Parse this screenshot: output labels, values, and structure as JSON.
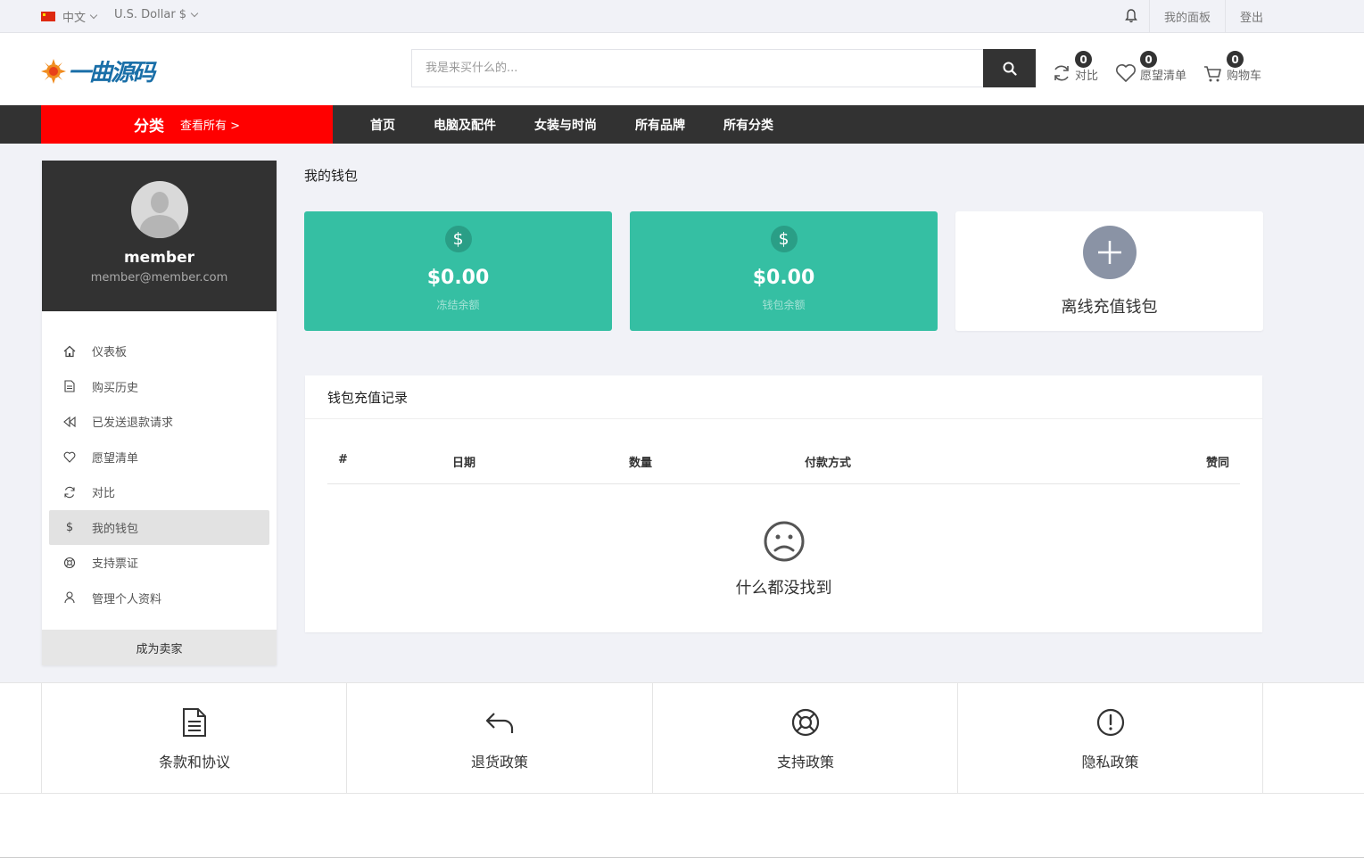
{
  "topbar": {
    "language": "中文",
    "currency": "U.S. Dollar $",
    "dashboard_link": "我的面板",
    "logout_link": "登出"
  },
  "header": {
    "logo_text": "一曲源码",
    "search_placeholder": "我是来买什么的...",
    "compare": {
      "count": "0",
      "label": "对比"
    },
    "wishlist": {
      "count": "0",
      "label": "愿望清单"
    },
    "cart": {
      "count": "0",
      "label": "购物车"
    }
  },
  "nav": {
    "category_title": "分类",
    "view_all": "查看所有 >",
    "links": [
      "首页",
      "电脑及配件",
      "女装与时尚",
      "所有品牌",
      "所有分类"
    ]
  },
  "sidebar": {
    "name": "member",
    "email": "member@member.com",
    "items": [
      {
        "label": "仪表板",
        "icon": "home-icon"
      },
      {
        "label": "购买历史",
        "icon": "file-icon"
      },
      {
        "label": "已发送退款请求",
        "icon": "rewind-icon"
      },
      {
        "label": "愿望清单",
        "icon": "heart-icon"
      },
      {
        "label": "对比",
        "icon": "refresh-icon"
      },
      {
        "label": "我的钱包",
        "icon": "dollar-icon"
      },
      {
        "label": "支持票证",
        "icon": "support-icon"
      },
      {
        "label": "管理个人资料",
        "icon": "user-icon"
      }
    ],
    "active_index": 5,
    "become_seller": "成为卖家"
  },
  "main": {
    "page_title": "我的钱包",
    "cards": [
      {
        "amount": "$0.00",
        "label": "冻结余额"
      },
      {
        "amount": "$0.00",
        "label": "钱包余额"
      }
    ],
    "offline_recharge": "离线充值钱包",
    "records_title": "钱包充值记录",
    "columns": [
      "#",
      "日期",
      "数量",
      "付款方式",
      "赞同"
    ],
    "empty_text": "什么都没找到"
  },
  "policies": [
    {
      "label": "条款和协议",
      "icon": "document-icon"
    },
    {
      "label": "退货政策",
      "icon": "return-arrow-icon"
    },
    {
      "label": "支持政策",
      "icon": "lifebuoy-icon"
    },
    {
      "label": "隐私政策",
      "icon": "alert-circle-icon"
    }
  ],
  "colors": {
    "accent_green": "#35bfa3",
    "category_red": "#ff0000",
    "dark": "#323232"
  }
}
